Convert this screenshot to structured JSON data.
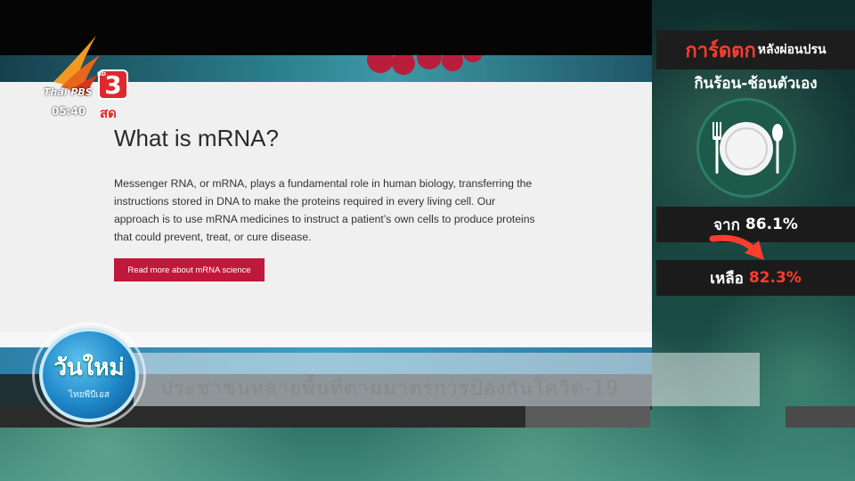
{
  "channel": {
    "brand": "Thai PBS",
    "hd_badge": "HD",
    "number": "3",
    "clock": "05:40",
    "live_label": "สด"
  },
  "program": {
    "title": "วันใหม่",
    "subtitle": "ไทยพีบีเอส"
  },
  "website": {
    "title": "What is mRNA?",
    "body": "Messenger RNA, or mRNA, plays a fundamental role in human biology, transferring the instructions stored in DNA to make the proteins required in every living cell. Our approach is to use mRNA medicines to instruct a patient’s own cells to produce proteins that could prevent, treat, or cure disease.",
    "button_label": "Read more about mRNA science"
  },
  "ticker": {
    "text": "ประชาชนหลายพื้นที่ตามมาตรการป้องกันโควิด-19"
  },
  "infographic": {
    "header_red": "การ์ดตก",
    "header_white": "หลังผ่อนปรน",
    "subheader": "กินร้อน-ช้อนตัวเอง",
    "icon": "plate-fork-spoon-icon",
    "from_label": "จาก",
    "from_value": "86.1%",
    "to_label": "เหลือ",
    "to_value": "82.3%",
    "accent_color": "#ff3d2e"
  }
}
